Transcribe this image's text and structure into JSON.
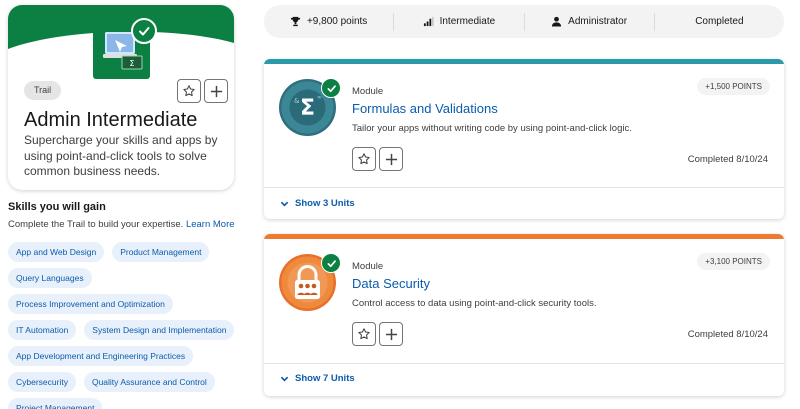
{
  "trail": {
    "tag": "Trail",
    "title": "Admin Intermediate",
    "description": "Supercharge your skills and apps by using point-and-click tools to solve common business needs.",
    "banner_color": "#0b8042",
    "badge_icon": "trail-badge-laptop-icon"
  },
  "skills": {
    "heading": "Skills you will gain",
    "subtitle": "Complete the Trail to build your expertise.",
    "learn_more": "Learn More",
    "items": [
      "App and Web Design",
      "Product Management",
      "Query Languages",
      "Process Improvement and Optimization",
      "IT Automation",
      "System Design and Implementation",
      "App Development and Engineering Practices",
      "Cybersecurity",
      "Quality Assurance and Control",
      "Project Management"
    ]
  },
  "status": {
    "points": "+9,800 points",
    "level": "Intermediate",
    "role": "Administrator",
    "state": "Completed"
  },
  "modules": [
    {
      "type": "Module",
      "title": "Formulas and Validations",
      "description": "Tailor your apps without writing code by using point-and-click logic.",
      "points": "+1,500 POINTS",
      "completed": "Completed 8/10/24",
      "show_units": "Show 3 Units",
      "accent": "#2a9aa8",
      "icon": "sigma-formula-icon"
    },
    {
      "type": "Module",
      "title": "Data Security",
      "description": "Control access to data using point-and-click security tools.",
      "points": "+3,100 POINTS",
      "completed": "Completed 8/10/24",
      "show_units": "Show 7 Units",
      "accent": "#ec7a30",
      "icon": "padlock-group-icon"
    }
  ]
}
